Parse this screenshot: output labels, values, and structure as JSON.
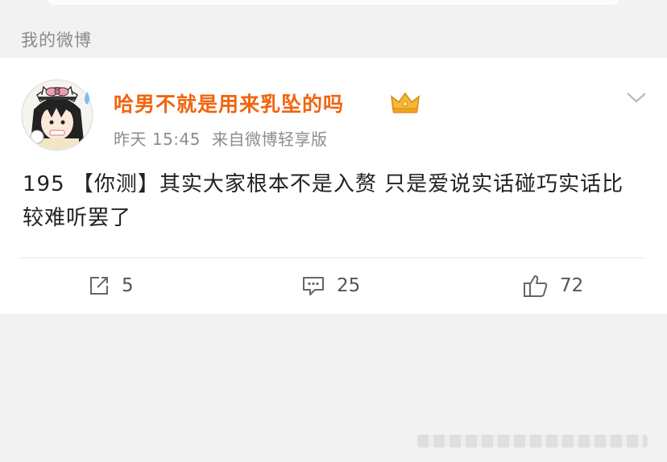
{
  "section": {
    "title": "我的微博"
  },
  "post": {
    "author": "哈男不就是用来乳坠的吗",
    "time": "昨天 15:45",
    "source": "来自微博轻享版",
    "text": "195 【你测】其实大家根本不是入赘 只是爱说实话碰巧实话比较难听罢了"
  },
  "actions": {
    "repost_count": "5",
    "comment_count": "25",
    "like_count": "72"
  },
  "colors": {
    "author": "#f0650f",
    "background": "#f2f2f2",
    "card": "#ffffff"
  },
  "icons": {
    "repost": "share-arrow-icon",
    "comment": "comment-bubble-icon",
    "like": "thumbs-up-icon",
    "badge": "crown-badge-icon",
    "menu": "chevron-down-icon"
  }
}
